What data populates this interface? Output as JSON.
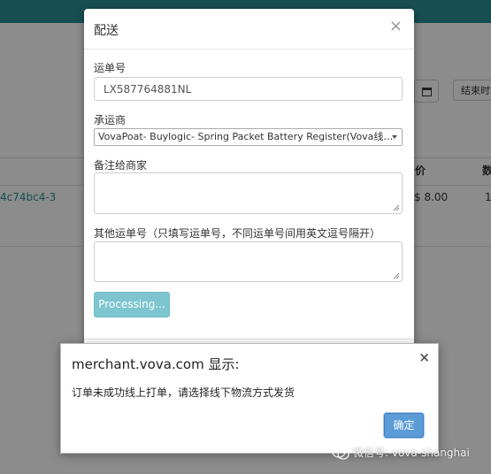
{
  "background": {
    "end_time_button": "结束时",
    "table_header_1": "价",
    "table_header_2": "数",
    "order_link": "4c74bc4-3",
    "price": "$ 8.00",
    "quantity": "1"
  },
  "shipping_modal": {
    "title": "配送",
    "close_icon": "×",
    "tracking_label": "运单号",
    "tracking_value": "LX587764881NL",
    "carrier_label": "承运商",
    "carrier_selected": "VovaPoat- Buylogic- Spring Packet Battery Register(Vova线…",
    "note_label": "备注给商家",
    "note_value": "",
    "other_tracking_label": "其他运单号（只填写运单号，不同运单号间用英文逗号隔开）",
    "other_tracking_value": "",
    "processing_button": "Processing..."
  },
  "alert": {
    "title": "merchant.vova.com 显示:",
    "message": "订单未成功线上打单，请选择线下物流方式发货",
    "ok_button": "确定",
    "close_icon": "×"
  },
  "watermark": {
    "text": "微信号: vova-shanghai",
    "icon": "wechat-icon"
  },
  "colors": {
    "topbar": "#2a8e96",
    "processing_button": "#7dc5cf",
    "ok_button": "#5b9bd8"
  }
}
